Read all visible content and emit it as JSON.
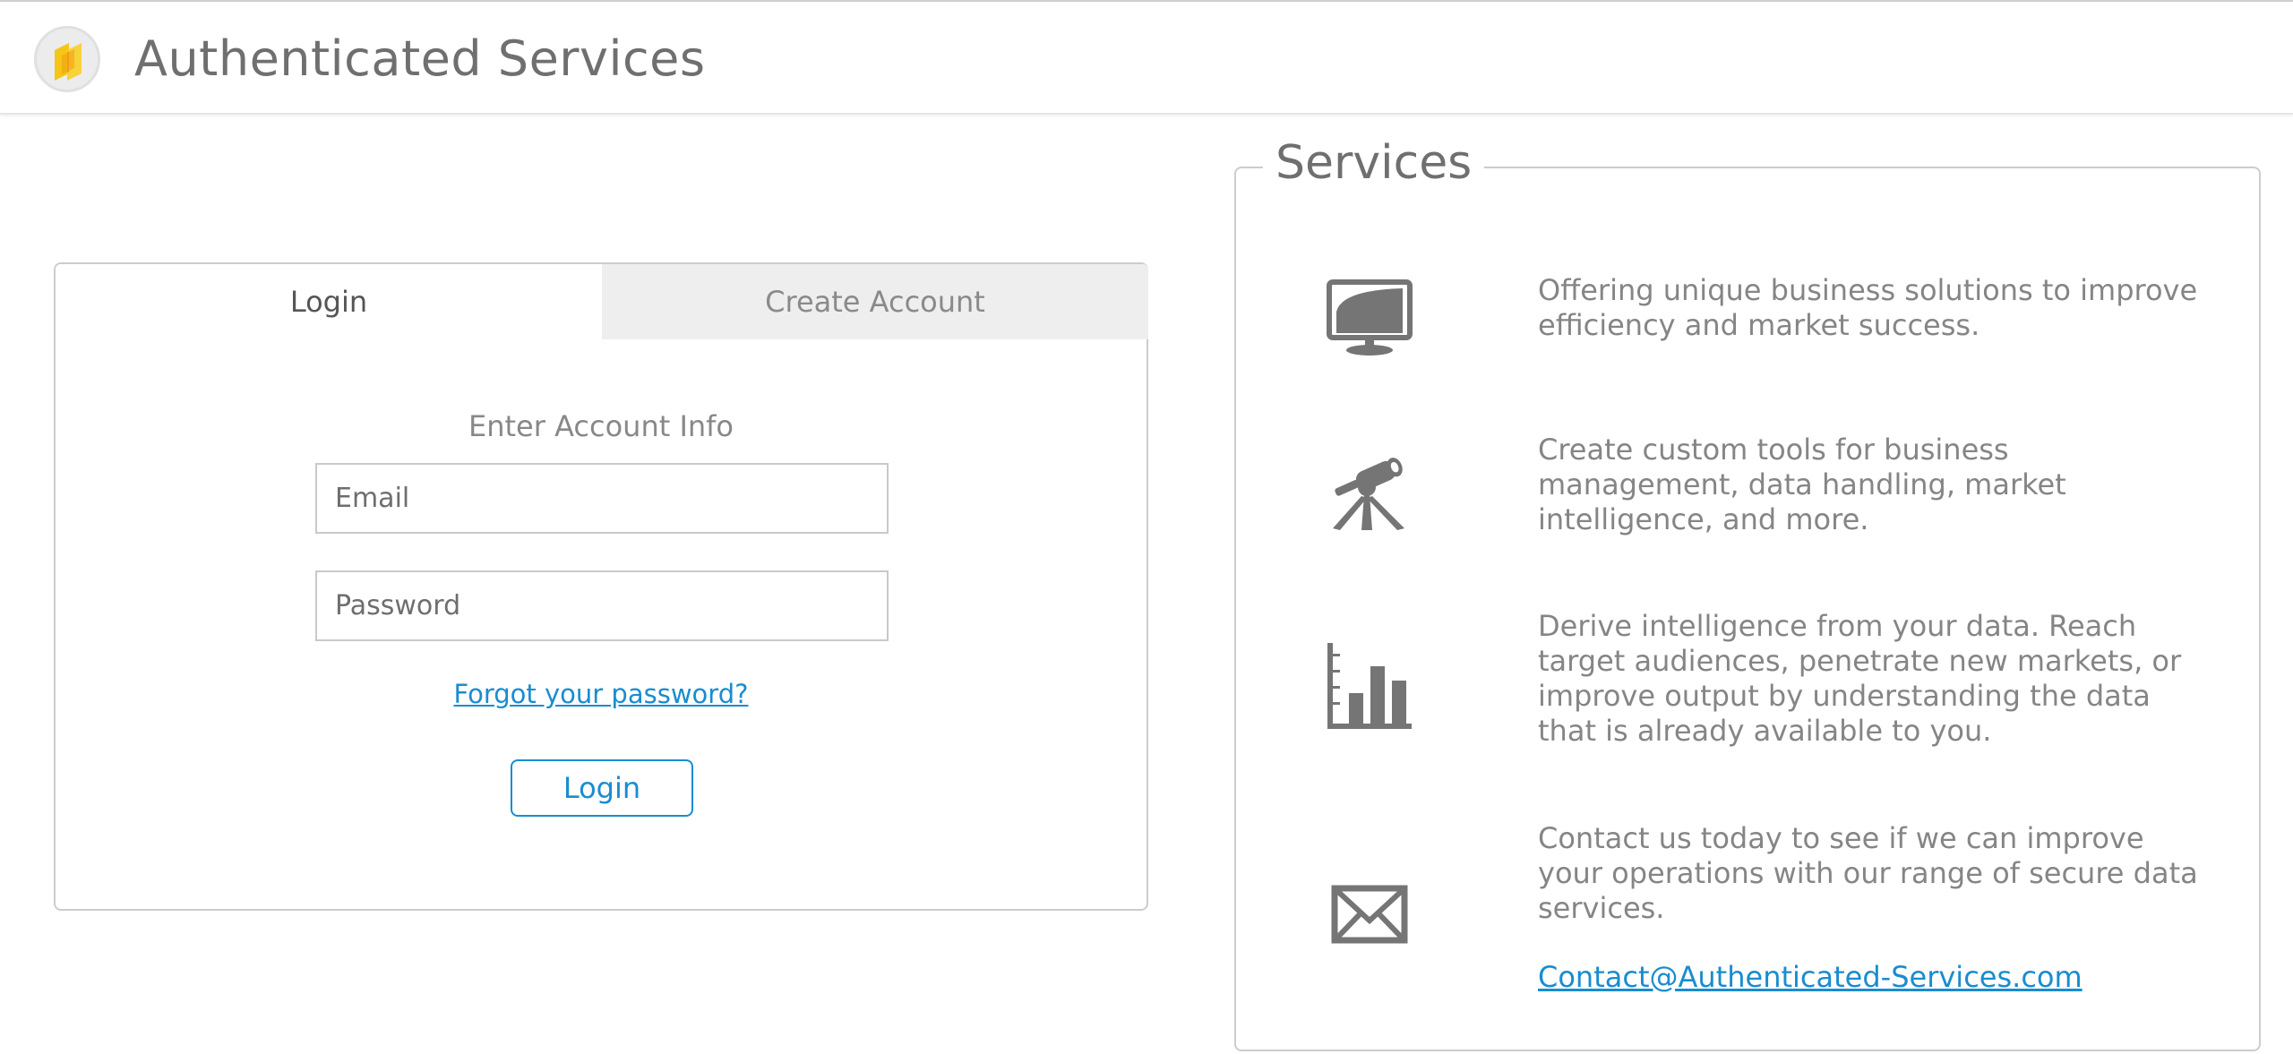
{
  "header": {
    "title": "Authenticated Services"
  },
  "login": {
    "tabs": [
      {
        "label": "Login",
        "active": true
      },
      {
        "label": "Create Account",
        "active": false
      }
    ],
    "form_title": "Enter Account Info",
    "email": {
      "placeholder": "Email",
      "value": ""
    },
    "password": {
      "placeholder": "Password",
      "value": ""
    },
    "forgot_link": "Forgot your password?",
    "submit_label": "Login"
  },
  "services": {
    "title": "Services",
    "items": [
      {
        "icon": "monitor-icon",
        "text": "Offering unique business solutions to improve efficiency and market success."
      },
      {
        "icon": "telescope-icon",
        "text": "Create custom tools for business management, data handling, market intelligence, and more."
      },
      {
        "icon": "bar-chart-icon",
        "text": "Derive intelligence from your data. Reach target audiences, penetrate new markets, or improve output by understanding the data that is already available to you."
      },
      {
        "icon": "envelope-icon",
        "text": "Contact us today to see if we can improve your operations with our range of secure data services."
      }
    ],
    "contact_email": "Contact@Authenticated-Services.com"
  },
  "colors": {
    "accent": "#1a8ccf",
    "icon": "#757575",
    "logo_yellow": "#f5c518",
    "logo_orange": "#f39c12"
  }
}
